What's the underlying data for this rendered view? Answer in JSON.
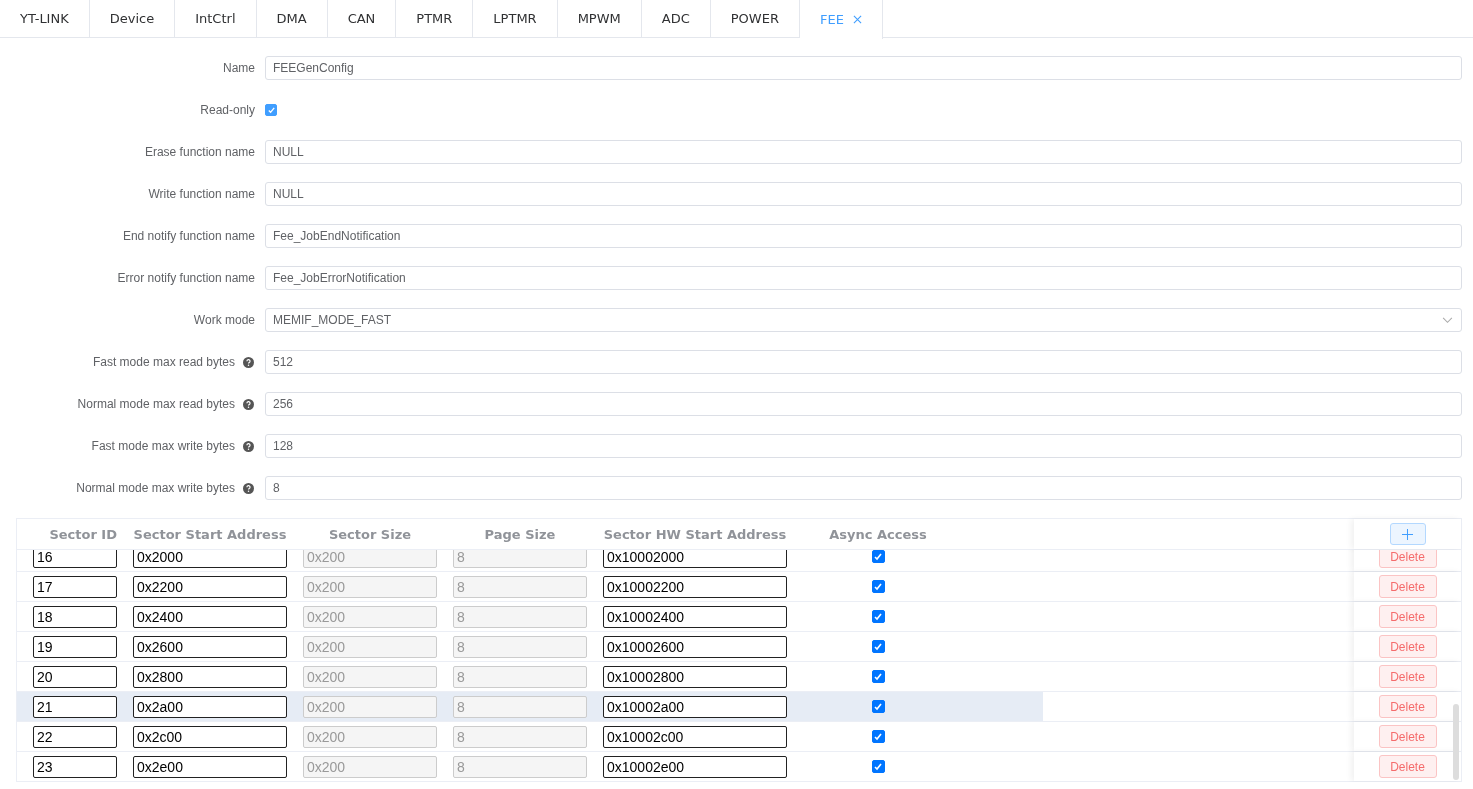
{
  "tabs": [
    {
      "label": "YT-LINK",
      "selected": false,
      "closable": false
    },
    {
      "label": "Device",
      "selected": false,
      "closable": false
    },
    {
      "label": "IntCtrl",
      "selected": false,
      "closable": false
    },
    {
      "label": "DMA",
      "selected": false,
      "closable": false
    },
    {
      "label": "CAN",
      "selected": false,
      "closable": false
    },
    {
      "label": "PTMR",
      "selected": false,
      "closable": false
    },
    {
      "label": "LPTMR",
      "selected": false,
      "closable": false
    },
    {
      "label": "MPWM",
      "selected": false,
      "closable": false
    },
    {
      "label": "ADC",
      "selected": false,
      "closable": false
    },
    {
      "label": "POWER",
      "selected": false,
      "closable": false
    },
    {
      "label": "FEE",
      "selected": true,
      "closable": true
    }
  ],
  "form": [
    {
      "kind": "text",
      "label": "Name",
      "value": "FEEGenConfig",
      "help": false
    },
    {
      "kind": "checkbox",
      "label": "Read-only",
      "checked": true,
      "help": false
    },
    {
      "kind": "text",
      "label": "Erase function name",
      "value": "NULL",
      "help": false
    },
    {
      "kind": "text",
      "label": "Write function name",
      "value": "NULL",
      "help": false
    },
    {
      "kind": "text",
      "label": "End notify function name",
      "value": "Fee_JobEndNotification",
      "help": false
    },
    {
      "kind": "text",
      "label": "Error notify function name",
      "value": "Fee_JobErrorNotification",
      "help": false
    },
    {
      "kind": "select",
      "label": "Work mode",
      "value": "MEMIF_MODE_FAST",
      "help": false
    },
    {
      "kind": "text",
      "label": "Fast mode max read bytes",
      "value": "512",
      "help": true
    },
    {
      "kind": "text",
      "label": "Normal mode max read bytes",
      "value": "256",
      "help": true
    },
    {
      "kind": "text",
      "label": "Fast mode max write bytes",
      "value": "128",
      "help": true
    },
    {
      "kind": "text",
      "label": "Normal mode max write bytes",
      "value": "8",
      "help": true
    }
  ],
  "sectors": {
    "columns": [
      "Sector ID",
      "Sector Start Address",
      "Sector Size",
      "Page Size",
      "Sector HW Start Address",
      "Async Access"
    ],
    "rows": [
      {
        "id": "16",
        "start": "0x2000",
        "size": "0x200",
        "page": "8",
        "hw": "0x10002000",
        "async": true,
        "highlighted": false,
        "action": "Delete"
      },
      {
        "id": "17",
        "start": "0x2200",
        "size": "0x200",
        "page": "8",
        "hw": "0x10002200",
        "async": true,
        "highlighted": false,
        "action": "Delete"
      },
      {
        "id": "18",
        "start": "0x2400",
        "size": "0x200",
        "page": "8",
        "hw": "0x10002400",
        "async": true,
        "highlighted": false,
        "action": "Delete"
      },
      {
        "id": "19",
        "start": "0x2600",
        "size": "0x200",
        "page": "8",
        "hw": "0x10002600",
        "async": true,
        "highlighted": false,
        "action": "Delete"
      },
      {
        "id": "20",
        "start": "0x2800",
        "size": "0x200",
        "page": "8",
        "hw": "0x10002800",
        "async": true,
        "highlighted": false,
        "action": "Delete"
      },
      {
        "id": "21",
        "start": "0x2a00",
        "size": "0x200",
        "page": "8",
        "hw": "0x10002a00",
        "async": true,
        "highlighted": true,
        "action": "Delete"
      },
      {
        "id": "22",
        "start": "0x2c00",
        "size": "0x200",
        "page": "8",
        "hw": "0x10002c00",
        "async": true,
        "highlighted": false,
        "action": "Delete"
      },
      {
        "id": "23",
        "start": "0x2e00",
        "size": "0x200",
        "page": "8",
        "hw": "0x10002e00",
        "async": true,
        "highlighted": false,
        "action": "Delete"
      }
    ]
  }
}
